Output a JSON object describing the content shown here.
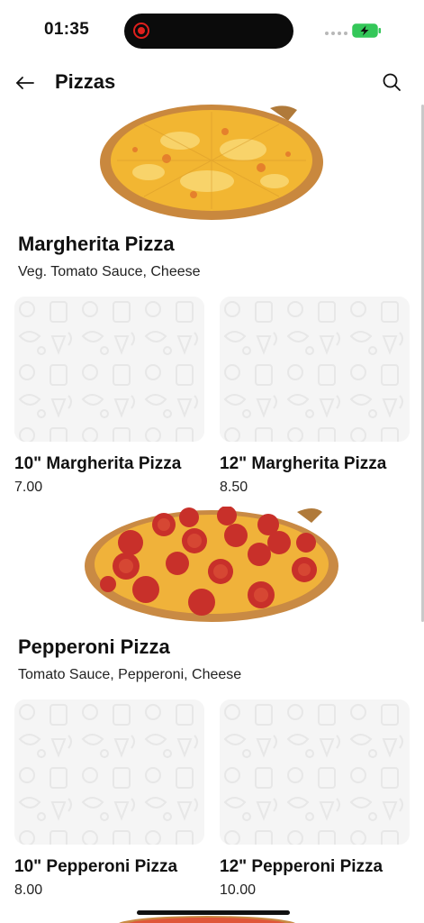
{
  "status_bar": {
    "time": "01:35"
  },
  "header": {
    "title": "Pizzas"
  },
  "sections": [
    {
      "title": "Margherita Pizza",
      "description": "Veg.  Tomato Sauce, Cheese",
      "items": [
        {
          "name": "10\" Margherita Pizza",
          "price": "7.00"
        },
        {
          "name": "12\" Margherita Pizza",
          "price": "8.50"
        }
      ]
    },
    {
      "title": "Pepperoni Pizza",
      "description": "Tomato Sauce, Pepperoni, Cheese",
      "items": [
        {
          "name": "10\" Pepperoni Pizza",
          "price": "8.00"
        },
        {
          "name": "12\" Pepperoni Pizza",
          "price": "10.00"
        }
      ]
    }
  ],
  "colors": {
    "recording": "#e0201d",
    "battery": "#34c759",
    "placeholder": "#f5f5f5"
  }
}
